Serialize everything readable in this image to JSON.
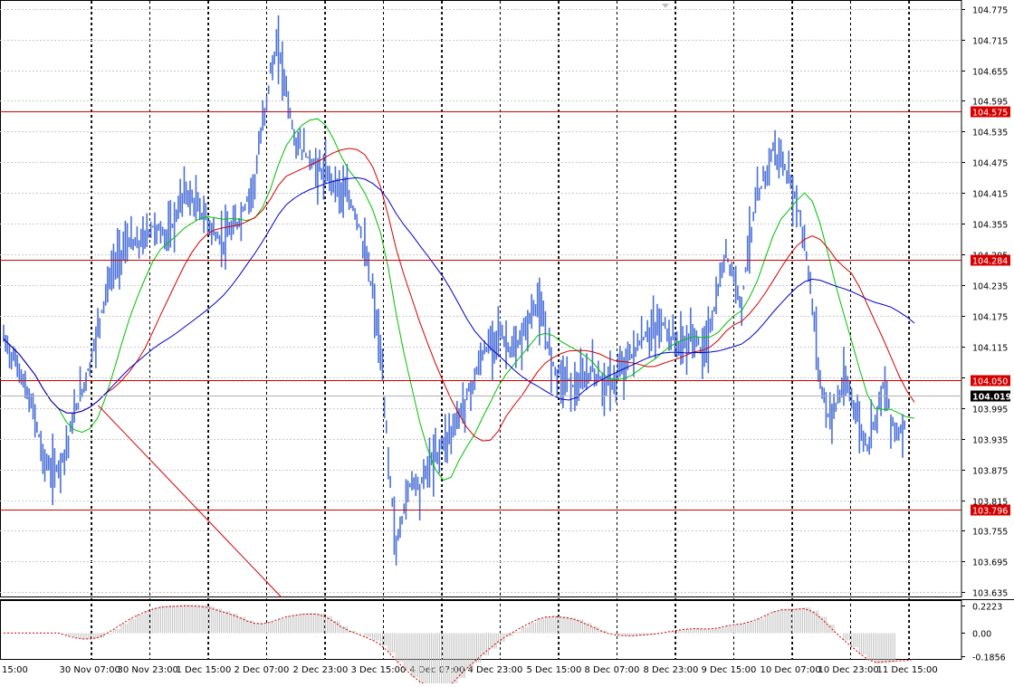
{
  "chart_data": {
    "type": "line",
    "description": "",
    "y_axis": {
      "ylim": [
        103.625,
        104.785
      ],
      "ticks": [
        104.775,
        104.715,
        104.655,
        104.595,
        104.535,
        104.475,
        104.415,
        104.355,
        104.295,
        104.235,
        104.175,
        104.115,
        104.055,
        103.995,
        103.935,
        103.875,
        103.815,
        103.755,
        103.695,
        103.635
      ],
      "tick_labels": [
        "104.775",
        "104.715",
        "104.655",
        "104.595",
        "104.535",
        "104.475",
        "104.415",
        "104.355",
        "104.295",
        "104.235",
        "104.175",
        "104.115",
        "104.055",
        "103.995",
        "103.935",
        "103.875",
        "103.815",
        "103.755",
        "103.695",
        "103.635"
      ]
    },
    "x_axis": {
      "tick_labels": [
        "15:00",
        "30 Nov 07:00",
        "30 Nov 23:00",
        "1 Dec 15:00",
        "2 Dec 07:00",
        "2 Dec 23:00",
        "3 Dec 15:00",
        "4 Dec 07:00",
        "4 Dec 23:00",
        "5 Dec 15:00",
        "8 Dec 07:00",
        "8 Dec 23:00",
        "9 Dec 15:00",
        "10 Dec 07:00",
        "10 Dec 23:00",
        "11 Dec 15:00"
      ]
    },
    "horizontal_levels": [
      {
        "value": 104.575,
        "label": "104.575",
        "color": "#d40000"
      },
      {
        "value": 104.284,
        "label": "104.284",
        "color": "#d40000"
      },
      {
        "value": 104.05,
        "label": "104.050",
        "color": "#d40000"
      },
      {
        "value": 103.796,
        "label": "103.796",
        "color": "#d40000"
      }
    ],
    "current_price": {
      "value": 104.019,
      "label": "104.019"
    },
    "price_series": {
      "name": "",
      "values": [
        104.13,
        104.1,
        104.07,
        104.02,
        103.98,
        103.9,
        103.87,
        103.88,
        103.92,
        103.98,
        104.03,
        104.08,
        104.15,
        104.22,
        104.27,
        104.3,
        104.32,
        104.31,
        104.33,
        104.35,
        104.34,
        104.33,
        104.37,
        104.42,
        104.4,
        104.38,
        104.36,
        104.33,
        104.32,
        104.34,
        104.36,
        104.4,
        104.44,
        104.55,
        104.65,
        104.7,
        104.62,
        104.52,
        104.5,
        104.48,
        104.46,
        104.45,
        104.44,
        104.42,
        104.4,
        104.37,
        104.3,
        104.22,
        104.1,
        103.9,
        103.72,
        103.8,
        103.86,
        103.84,
        103.88,
        103.9,
        103.93,
        103.95,
        103.98,
        104.02,
        104.05,
        104.1,
        104.12,
        104.15,
        104.12,
        104.1,
        104.13,
        104.17,
        104.2,
        104.14,
        104.08,
        104.06,
        104.05,
        104.03,
        104.05,
        104.07,
        104.05,
        104.04,
        104.05,
        104.08,
        104.1,
        104.12,
        104.14,
        104.15,
        104.16,
        104.13,
        104.12,
        104.12,
        104.14,
        104.1,
        104.15,
        104.22,
        104.3,
        104.25,
        104.2,
        104.33,
        104.4,
        104.45,
        104.5,
        104.48,
        104.44,
        104.4,
        104.32,
        104.2,
        104.05,
        103.98,
        104.0,
        104.04,
        104.02,
        103.96,
        103.92,
        103.98,
        104.04,
        103.98,
        103.94,
        103.98,
        104.0
      ]
    },
    "moving_averages": [
      {
        "name": "",
        "color": "#00c000",
        "period": 8
      },
      {
        "name": "",
        "color": "#d40000",
        "period": 14
      },
      {
        "name": "",
        "color": "#0000c8",
        "period": 24
      }
    ],
    "trendline": {
      "from": {
        "x_label": "30 Nov 07:00",
        "y": 104.0
      },
      "to": {
        "x_label": "3 Dec 15:00",
        "y": 103.625
      },
      "color": "#d40000"
    },
    "oscillator": {
      "ticks": [
        0.2223,
        0.0,
        -0.1856
      ],
      "tick_labels": [
        "0.2223",
        "0.00",
        "-0.1856"
      ],
      "ylim": [
        -0.21,
        0.26
      ]
    },
    "grid": true,
    "legend": "none"
  }
}
